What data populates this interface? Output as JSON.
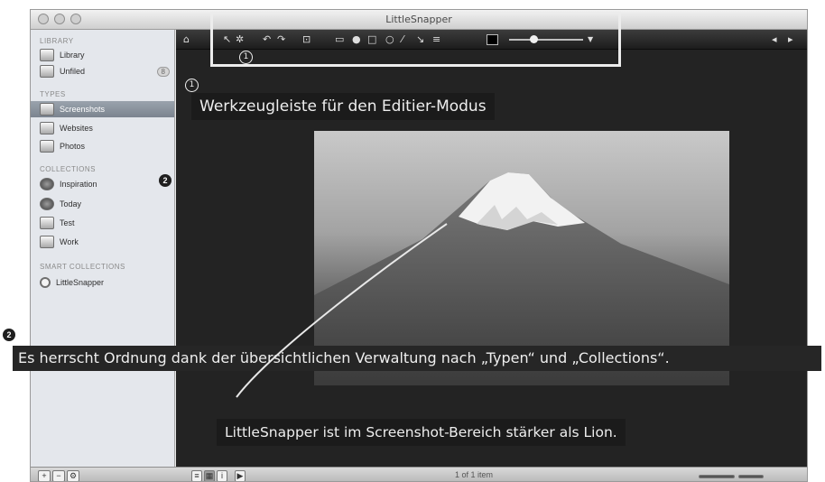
{
  "window": {
    "title": "LittleSnapper",
    "traffic_lights": [
      "close",
      "minimize",
      "zoom"
    ]
  },
  "sidebar": {
    "library_heading": "Library",
    "library_items": [
      {
        "label": "Library",
        "icon": "library-icon"
      },
      {
        "label": "Unfiled",
        "icon": "inbox-icon",
        "badge": "8"
      }
    ],
    "types_heading": "Types",
    "types_items": [
      {
        "label": "Screenshots",
        "icon": "screenshot-icon",
        "selected": true
      },
      {
        "label": "Websites",
        "icon": "website-icon"
      },
      {
        "label": "Photos",
        "icon": "photo-icon"
      }
    ],
    "collections_heading": "Collections",
    "collections_items": [
      {
        "label": "Inspiration",
        "icon": "globe-icon"
      },
      {
        "label": "Today",
        "icon": "globe-icon"
      },
      {
        "label": "Test",
        "icon": "collection-icon"
      },
      {
        "label": "Work",
        "icon": "collection-icon"
      }
    ],
    "smart_heading": "Smart Collections",
    "smart_items": [
      {
        "label": "LittleSnapper",
        "icon": "magnifier-icon"
      }
    ]
  },
  "edit_toolbar": {
    "icons": [
      "home-icon",
      "pointer-icon",
      "star-icon",
      "rotate-left-icon",
      "rotate-right-icon",
      "crop-icon",
      "text-icon",
      "drop-icon",
      "rectangle-icon",
      "ellipse-icon",
      "line-icon",
      "arrow-icon",
      "blur-icon",
      "color-swatch-icon",
      "stroke-slider-icon",
      "prev-icon",
      "next-icon"
    ],
    "swatch_color": "#000000"
  },
  "annotations": {
    "marker_1": "1",
    "caption_toolbar": "Werkzeugleiste für den Editier-Modus",
    "marker_2": "2",
    "caption_sidebar": "Es herrscht Ordnung dank der übersichtlichen Verwaltung nach „Typen“ und „Collections“.",
    "caption_screenshot": "LittleSnapper ist im Screenshot-Bereich stärker als Lion.",
    "highlight_color": "#ececec"
  },
  "bottom_bar": {
    "buttons": [
      "+",
      "−",
      "gear"
    ],
    "view_buttons": [
      "list",
      "grid",
      "info"
    ],
    "status": "1 of 1 item"
  }
}
